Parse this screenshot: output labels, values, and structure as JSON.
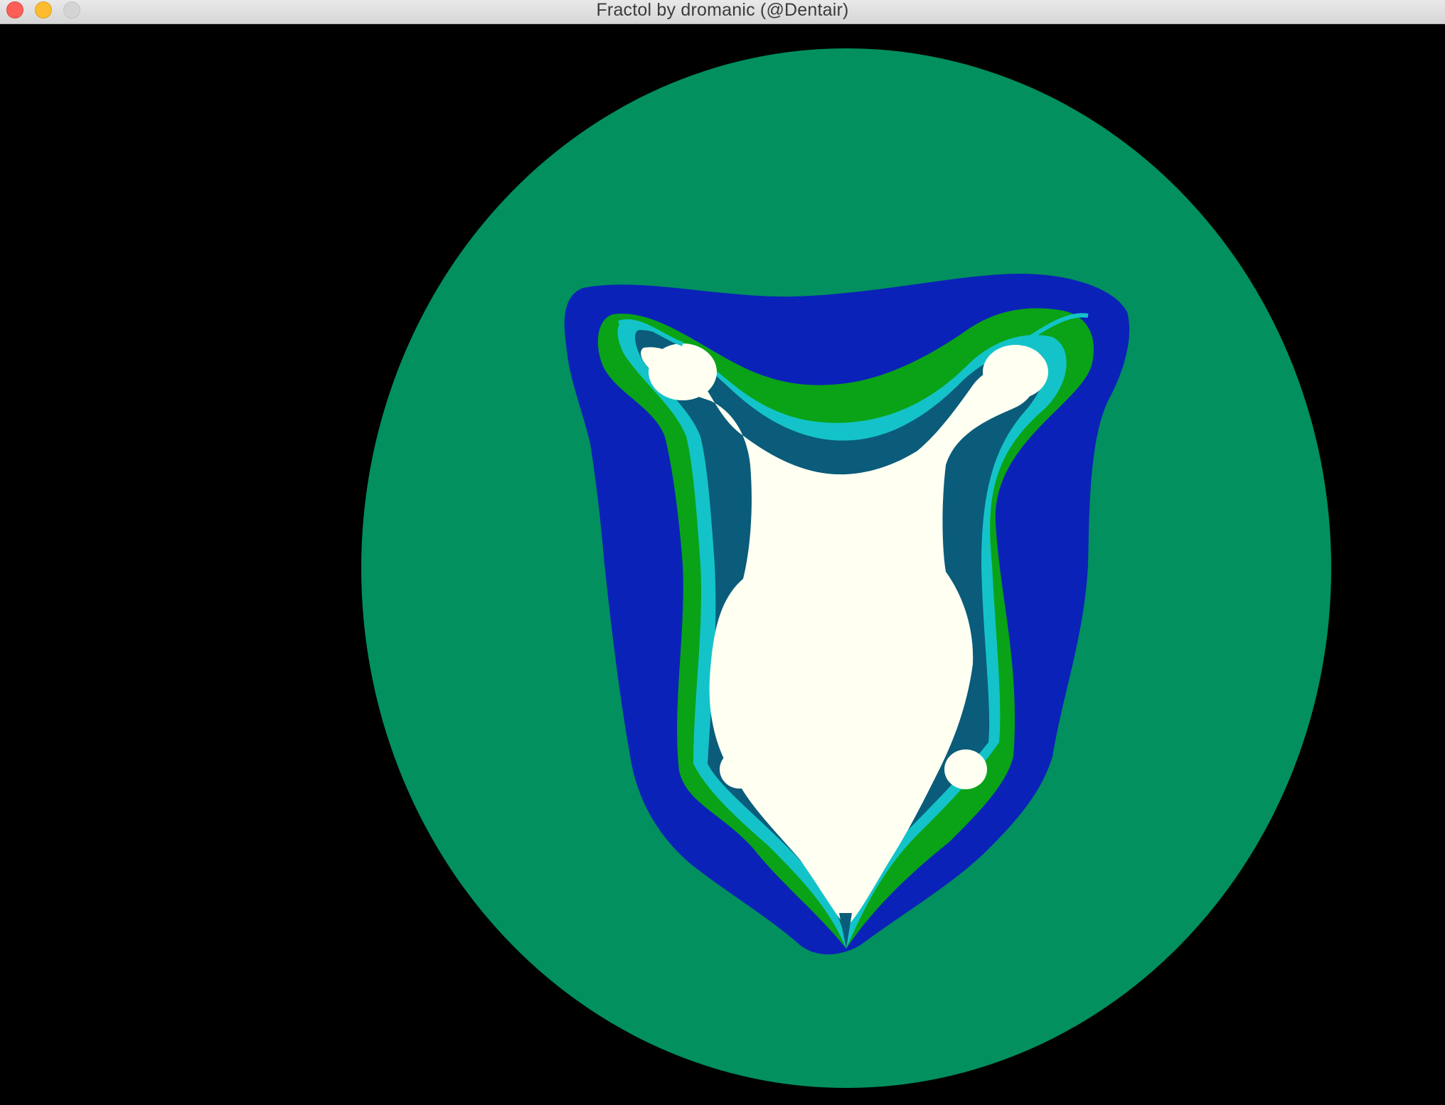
{
  "window": {
    "title": "Fractol by dromanic (@Dentair)",
    "controls": {
      "close_icon": "close-icon",
      "minimize_icon": "minimize-icon",
      "zoom_icon": "zoom-icon"
    }
  },
  "colors": {
    "background": "#000000",
    "outer_band": "#02905e",
    "blue_band": "#0b22b8",
    "green_band": "#0aa317",
    "teal_band": "#14c3c9",
    "dark_band": "#0a5c7a",
    "interior": "#fffff2"
  }
}
